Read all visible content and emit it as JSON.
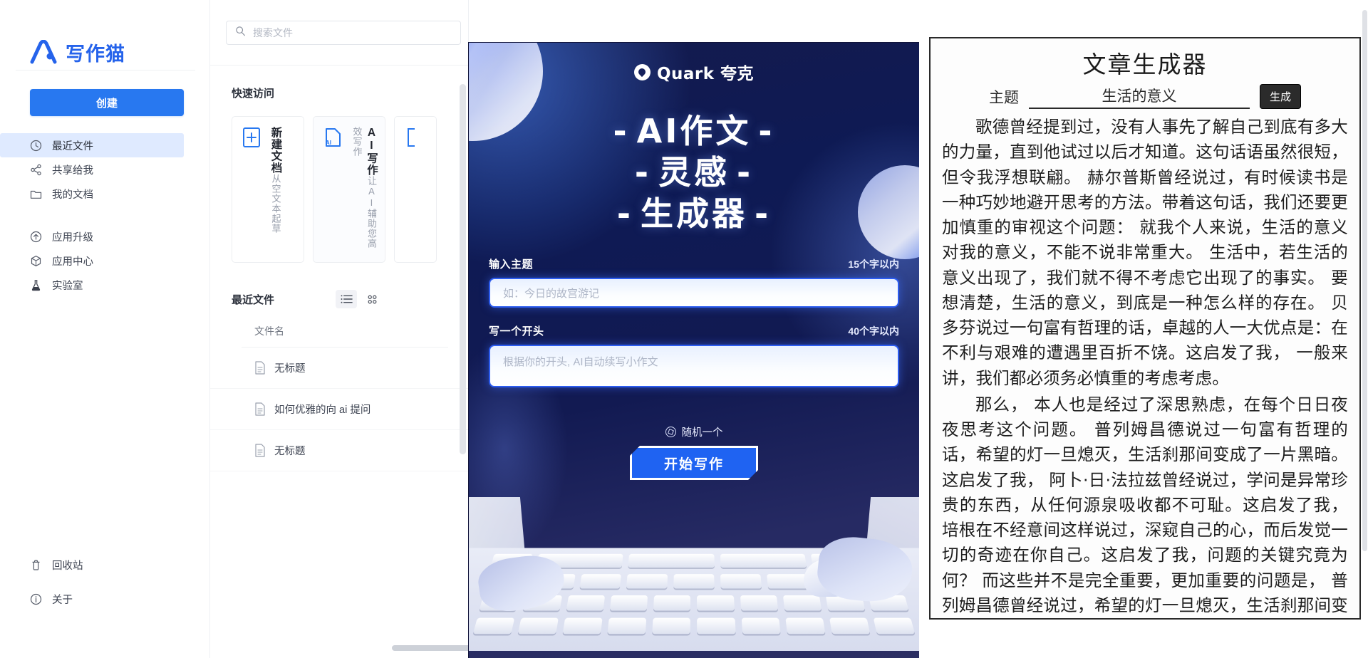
{
  "sidebar": {
    "brand": "写作猫",
    "create_label": "创建",
    "items": [
      {
        "label": "最近文件",
        "icon": "clock-icon",
        "active": true
      },
      {
        "label": "共享给我",
        "icon": "share-icon",
        "active": false
      },
      {
        "label": "我的文档",
        "icon": "folder-icon",
        "active": false
      },
      {
        "label": "应用升级",
        "icon": "upgrade-icon",
        "active": false
      },
      {
        "label": "应用中心",
        "icon": "cube-icon",
        "active": false
      },
      {
        "label": "实验室",
        "icon": "flask-icon",
        "active": false
      }
    ],
    "bottom_items": [
      {
        "label": "回收站",
        "icon": "trash-icon"
      },
      {
        "label": "关于",
        "icon": "info-icon"
      }
    ]
  },
  "files": {
    "search_placeholder": "搜索文件",
    "quick_access_title": "快速访问",
    "quick_cards": [
      {
        "title": "新建文档",
        "desc": "从空文本起草",
        "icon": "new-doc-icon"
      },
      {
        "title": "AI写作",
        "desc": "让AI辅助您高效写作",
        "icon": "ai-doc-icon"
      }
    ],
    "recent_title": "最近文件",
    "view_list_label": "列表视图",
    "view_grid_label": "网格视图",
    "column_name": "文件名",
    "rows": [
      {
        "name": "无标题"
      },
      {
        "name": "如何优雅的向 ai 提问"
      },
      {
        "name": "无标题"
      }
    ]
  },
  "quark": {
    "logo_text": "Quark 夸克",
    "hero_lines": [
      "AI作文",
      "灵感",
      "生成器"
    ],
    "topic_label": "输入主题",
    "topic_limit": "15个字以内",
    "topic_placeholder": "如：今日的故宫游记",
    "opening_label": "写一个开头",
    "opening_limit": "40个字以内",
    "opening_placeholder": "根据你的开头, AI自动续写小作文",
    "random_label": "随机一个",
    "start_label": "开始写作"
  },
  "article": {
    "title": "文章生成器",
    "topic_label": "主题",
    "topic_value": "生活的意义",
    "generate_label": "生成",
    "paragraphs": [
      "歌德曾经提到过，没有人事先了解自己到底有多大的力量，直到他试过以后才知道。这句话语虽然很短，但令我浮想联翩。 赫尔普斯曾经说过，有时候读书是一种巧妙地避开思考的方法。带着这句话，我们还要更加慎重的审视这个问题： 就我个人来说，生活的意义对我的意义，不能不说非常重大。 生活中，若生活的意义出现了，我们就不得不考虑它出现了的事实。 要想清楚，生活的意义，到底是一种怎么样的存在。 贝多芬说过一句富有哲理的话，卓越的人一大优点是：在不利与艰难的遭遇里百折不饶。这启发了我， 一般来讲，我们都必须务必慎重的考虑考虑。",
      "那么， 本人也是经过了深思熟虑，在每个日日夜夜思考这个问题。 普列姆昌德说过一句富有哲理的话，希望的灯一旦熄灭，生活刹那间变成了一片黑暗。这启发了我， 阿卜·日·法拉兹曾经说过，学问是异常珍贵的东西，从任何源泉吸收都不可耻。这启发了我， 培根在不经意间这样说过，深窥自己的心，而后发觉一切的奇迹在你自己。这启发了我，问题的关键究竟为何？ 而这些并不是完全重要，更加重要的问题是， 普列姆昌德曾经说过，希望的灯一旦熄灭，生活刹那间变成了一片黑暗。这似乎解"
    ]
  }
}
